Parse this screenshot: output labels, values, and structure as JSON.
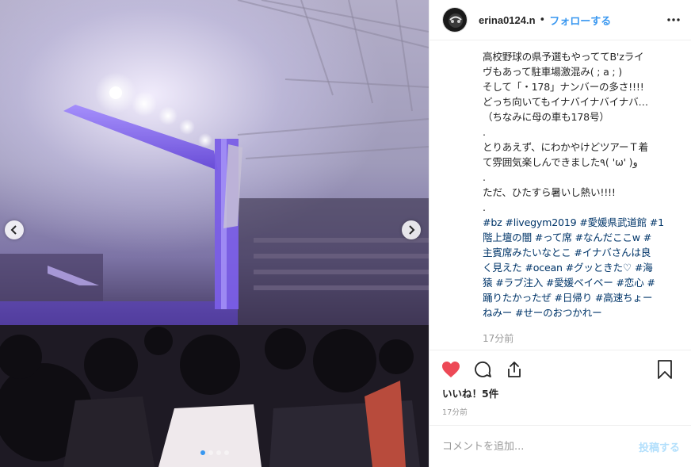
{
  "post": {
    "username": "erina0124.n",
    "separator": "•",
    "follow_label": "フォローする",
    "more_icon": "more-horizontal-icon",
    "caption_lines": [
      "高校野球の県予選もやっててB'zライ",
      "ヴもあって駐車場激混み( ; a ; )",
      "そして「・178」ナンバーの多さ!!!!",
      "どっち向いてもイナバイナバイナバ…",
      "（ちなみに母の車も178号）",
      ".",
      "とりあえず、にわかやけどツアーＴ着",
      "て雰囲気楽しんできました٩( 'ω' )و",
      ".",
      "ただ、ひたすら暑いし熱い!!!!",
      "."
    ],
    "hashtag_lines": [
      "#bz #livegym2019 #愛媛県武道館 #1",
      "階上壇の闇 #って席 #なんだここw #",
      "主賓席みたいなとこ #イナバさんは良",
      "く見えた #ocean #グッときた♡ #海",
      "猿 #ラブ注入 #愛媛ベイベー #恋心 #",
      "踊りたかったぜ #日帰り #高速ちょー",
      "ねみー #せーのおつかれー"
    ],
    "caption_time": "17分前",
    "likes": "いいね！5件",
    "post_time": "17分前",
    "comment_placeholder": "コメントを追加...",
    "post_button": "投稿する",
    "carousel": {
      "slide_count": 4,
      "active_index": 0
    },
    "colors": {
      "link": "#3897f0",
      "like": "#ed4956",
      "hashtag": "#003569",
      "muted": "#999999"
    }
  }
}
